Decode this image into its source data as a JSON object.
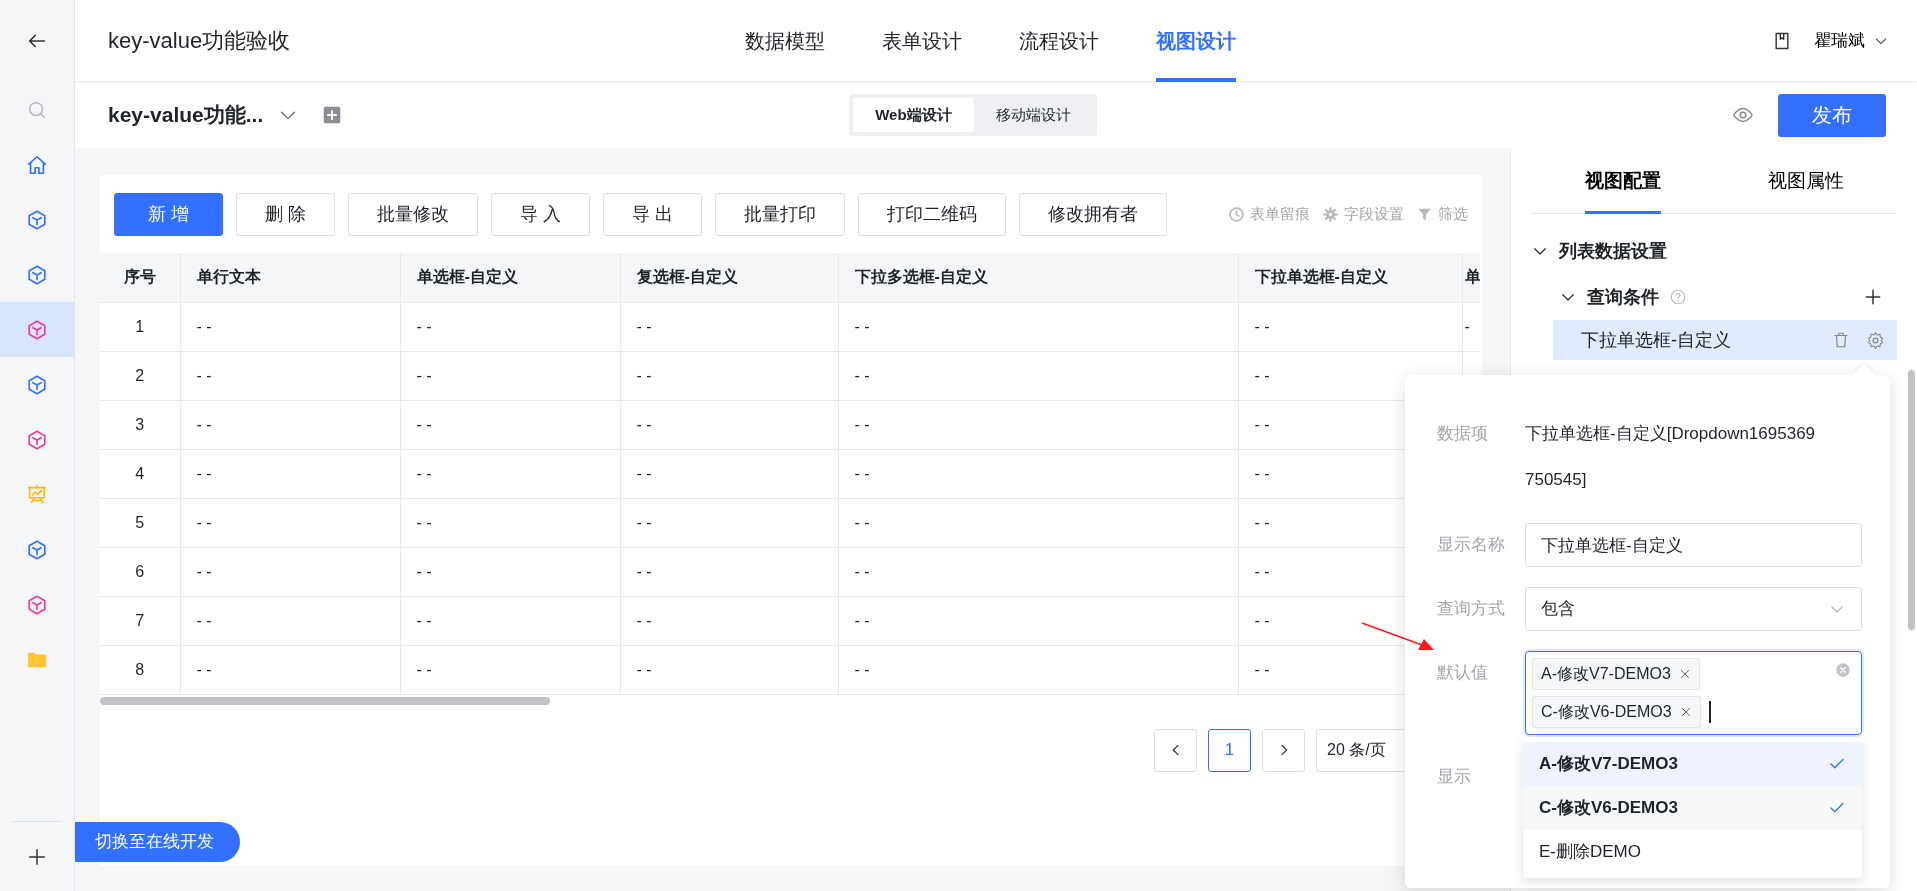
{
  "sidebar": {
    "back": {
      "kind": "back"
    },
    "search": {
      "kind": "search"
    },
    "items": [
      {
        "kind": "home",
        "color": "#3370ff",
        "selected": false
      },
      {
        "kind": "cube",
        "color": "#3370ff",
        "selected": false
      },
      {
        "kind": "cube",
        "color": "#3370ff",
        "selected": false
      },
      {
        "kind": "cube",
        "color": "#f0399a",
        "selected": true
      },
      {
        "kind": "cube",
        "color": "#3370ff",
        "selected": false
      },
      {
        "kind": "cube",
        "color": "#f0399a",
        "selected": false
      },
      {
        "kind": "board",
        "color": "#ffb800",
        "selected": false
      },
      {
        "kind": "cube",
        "color": "#3370ff",
        "selected": false
      },
      {
        "kind": "cube",
        "color": "#f0399a",
        "selected": false
      },
      {
        "kind": "folder",
        "color": "#ffc533",
        "selected": false
      }
    ]
  },
  "header": {
    "title": "key-value功能验收",
    "tabs": [
      {
        "label": "数据模型",
        "selected": false
      },
      {
        "label": "表单设计",
        "selected": false
      },
      {
        "label": "流程设计",
        "selected": false
      },
      {
        "label": "视图设计",
        "selected": true
      }
    ],
    "user": "瞿瑞斌"
  },
  "subbar": {
    "form_name": "key-value功能...",
    "segments": [
      {
        "label": "Web端设计",
        "selected": true
      },
      {
        "label": "移动端设计",
        "selected": false
      }
    ],
    "publish": "发布"
  },
  "toolbar": {
    "buttons": [
      {
        "label": "新 增",
        "kind": "primary"
      },
      {
        "label": "删 除",
        "kind": "default"
      },
      {
        "label": "批量修改",
        "kind": "default"
      },
      {
        "label": "导 入",
        "kind": "default"
      },
      {
        "label": "导 出",
        "kind": "default"
      },
      {
        "label": "批量打印",
        "kind": "default"
      },
      {
        "label": "打印二维码",
        "kind": "default"
      },
      {
        "label": "修改拥有者",
        "kind": "default"
      }
    ],
    "links": [
      {
        "label": "表单留痕",
        "kind": "history"
      },
      {
        "label": "字段设置",
        "kind": "gear"
      },
      {
        "label": "筛选",
        "kind": "filter"
      }
    ]
  },
  "table": {
    "columns": [
      "序号",
      "单行文本",
      "单选框-自定义",
      "复选框-自定义",
      "下拉多选框-自定义",
      "下拉单选框-自定义",
      "单"
    ],
    "rows": [
      [
        "1",
        "- -",
        "- -",
        "- -",
        "- -",
        "- -",
        "-"
      ],
      [
        "2",
        "- -",
        "- -",
        "- -",
        "- -",
        "- -"
      ],
      [
        "3",
        "- -",
        "- -",
        "- -",
        "- -",
        "- -"
      ],
      [
        "4",
        "- -",
        "- -",
        "- -",
        "- -",
        "- -"
      ],
      [
        "5",
        "- -",
        "- -",
        "- -",
        "- -",
        "- -"
      ],
      [
        "6",
        "- -",
        "- -",
        "- -",
        "- -",
        "- -"
      ],
      [
        "7",
        "- -",
        "- -",
        "- -",
        "- -",
        "- -"
      ],
      [
        "8",
        "- -",
        "- -",
        "- -",
        "- -",
        "- -"
      ]
    ]
  },
  "pagination": {
    "pages": [
      {
        "label": "1",
        "selected": true
      }
    ],
    "page_size": "20 条/页"
  },
  "switch_button": "切换至在线开发",
  "panel": {
    "tabs": [
      {
        "label": "视图配置",
        "selected": true
      },
      {
        "label": "视图属性",
        "selected": false
      }
    ],
    "tree": [
      {
        "label": "列表数据设置",
        "expanded": true,
        "children": [
          {
            "label": "查询条件",
            "expanded": true,
            "help": true,
            "children": [
              {
                "label": "下拉单选框-自定义",
                "selected": true
              }
            ]
          }
        ]
      }
    ]
  },
  "popover": {
    "fields": [
      {
        "kind": "text",
        "label": "数据项",
        "value": "下拉单选框-自定义[Dropdown1695369750545]"
      },
      {
        "kind": "input",
        "label": "显示名称",
        "value": "下拉单选框-自定义"
      },
      {
        "kind": "select",
        "label": "查询方式",
        "value": "包含"
      },
      {
        "kind": "tags",
        "label": "默认值",
        "tags": [
          "A-修改V7-DEMO3",
          "C-修改V6-DEMO3"
        ]
      },
      {
        "kind": "label",
        "label": "显示"
      }
    ],
    "options": [
      {
        "label": "A-修改V7-DEMO3",
        "selected": true,
        "active": true
      },
      {
        "label": "C-修改V6-DEMO3",
        "selected": true,
        "active": false
      },
      {
        "label": "E-删除DEMO",
        "selected": false,
        "active": false
      }
    ]
  }
}
